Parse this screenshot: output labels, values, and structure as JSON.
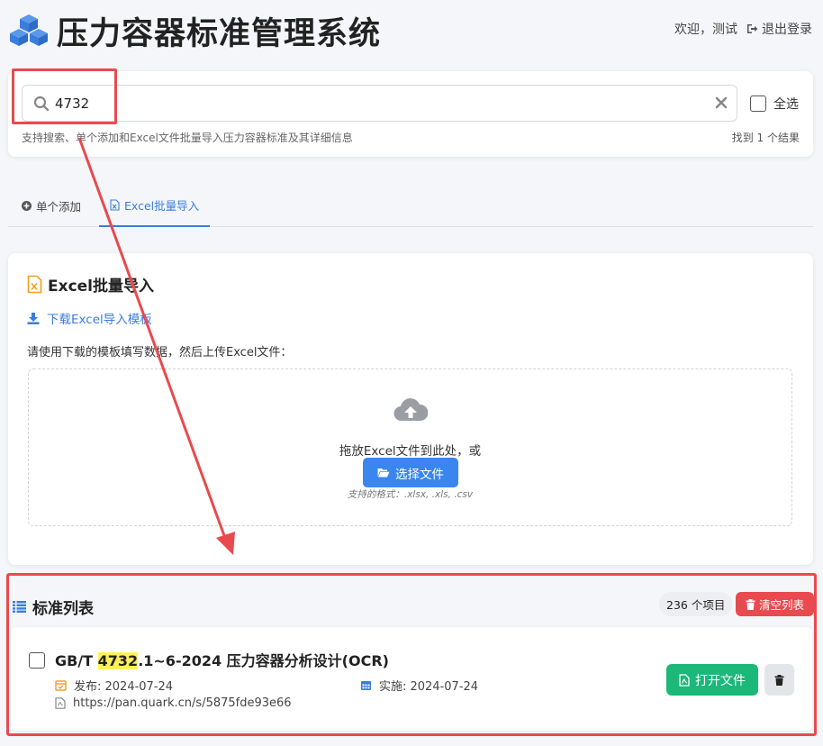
{
  "header": {
    "title": "压力容器标准管理系统",
    "welcome": "欢迎，测试",
    "logout_label": "退出登录"
  },
  "search": {
    "value": "4732",
    "placeholder": "",
    "select_all_label": "全选",
    "hint": "支持搜索、单个添加和Excel文件批量导入压力容器标准及其详细信息",
    "result_count": "找到 1 个结果"
  },
  "tabs": [
    {
      "label": "单个添加",
      "icon": "plus-circle-icon",
      "active": false
    },
    {
      "label": "Excel批量导入",
      "icon": "excel-file-icon",
      "active": true
    }
  ],
  "excel_import": {
    "title": "Excel批量导入",
    "download_label": "下载Excel导入模板",
    "instruction": "请使用下载的模板填写数据，然后上传Excel文件：",
    "drop_text": "拖放Excel文件到此处，或",
    "choose_label": "选择文件",
    "formats": "支持的格式：.xlsx, .xls, .csv"
  },
  "list": {
    "title": "标准列表",
    "count_label": "236 个项目",
    "clear_label": "清空列表",
    "items": [
      {
        "title_prefix": "GB/T ",
        "title_highlight": "4732",
        "title_suffix": ".1~6-2024 压力容器分析设计(OCR)",
        "publish": "发布: 2024-07-24",
        "implement": "实施: 2024-07-24",
        "link": "https://pan.quark.cn/s/5875fde93e66",
        "open_label": "打开文件"
      }
    ]
  },
  "colors": {
    "accent": "#3b7ddd",
    "danger": "#e84a4f",
    "success": "#1bb87a",
    "highlight": "#fff15a"
  }
}
